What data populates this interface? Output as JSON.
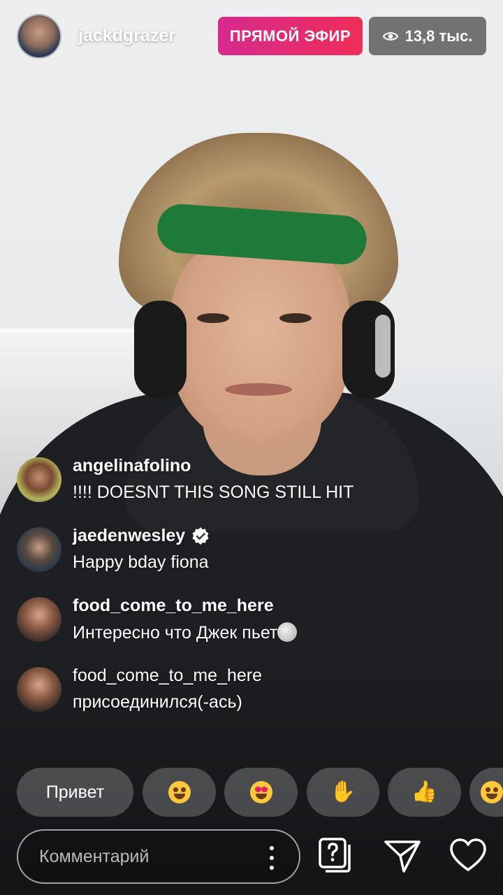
{
  "header": {
    "host_username": "jackdgrazer",
    "live_label": "ПРЯМОЙ ЭФИР",
    "viewer_count": "13,8 тыс."
  },
  "comments": [
    {
      "username": "angelinafolino",
      "text": "!!!! DOESNT THIS SONG STILL HIT",
      "verified": false
    },
    {
      "username": "jaedenwesley",
      "text": "Happy bday fiona",
      "verified": true
    },
    {
      "username": "food_come_to_me_here",
      "text": "Интересно что Джек пьет",
      "verified": false
    },
    {
      "username": "food_come_to_me_here",
      "text": "присоединился(-ась)",
      "verified": false,
      "join_event": true
    }
  ],
  "quick_replies": {
    "text_reply": "Привет",
    "emojis": [
      "face-with-tears-of-joy",
      "heart-eyes",
      "waving-hand",
      "thumbs-up",
      "face-with-tears-of-joy"
    ]
  },
  "composer": {
    "placeholder": "Комментарий"
  },
  "colors": {
    "live_gradient_start": "#d62a8e",
    "live_gradient_end": "#ef2d58"
  }
}
